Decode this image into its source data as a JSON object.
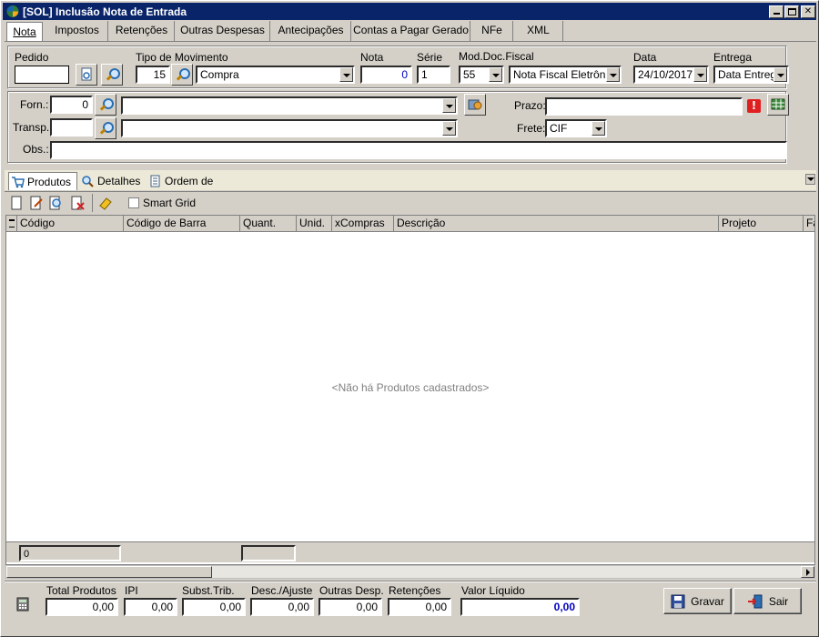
{
  "window": {
    "title": "[SOL] Inclusão Nota de Entrada"
  },
  "tabs": [
    "Nota",
    "Impostos",
    "Retenções",
    "Outras Despesas",
    "Antecipações",
    "Contas a Pagar Gerado",
    "NFe",
    "XML"
  ],
  "header_form": {
    "pedido_label": "Pedido",
    "pedido_value": "",
    "tipo_mov_label": "Tipo de Movimento",
    "tipo_mov_code": "15",
    "tipo_mov_desc": "Compra",
    "nota_label": "Nota",
    "nota_value": "0",
    "serie_label": "Série",
    "serie_value": "1",
    "mod_doc_label": "Mod.Doc.Fiscal",
    "mod_doc_code": "55",
    "mod_doc_desc": "Nota Fiscal Eletrônica",
    "data_label": "Data",
    "data_value": "24/10/2017",
    "entrega_label": "Entrega",
    "entrega_value": "Data Entrega"
  },
  "party_form": {
    "forn_label": "Forn.:",
    "forn_code": "0",
    "forn_name": "",
    "transp_label": "Transp.:",
    "transp_code": "",
    "transp_name": "",
    "prazo_label": "Prazo:",
    "prazo_value": "",
    "frete_label": "Frete:",
    "frete_value": "CIF",
    "obs_label": "Obs.:",
    "obs_value": ""
  },
  "subtabs": [
    "Produtos",
    "Detalhes",
    "Ordem de Compra"
  ],
  "toolbar": {
    "smart_grid_label": "Smart Grid",
    "smart_grid_checked": false
  },
  "grid": {
    "columns": [
      "Código",
      "Código de Barra",
      "Quant.",
      "Unid.",
      "xCompras",
      "Descrição",
      "Projeto",
      "Fa"
    ],
    "empty_text": "<Não há Produtos cadastrados>",
    "footer_count": "0"
  },
  "totals": {
    "total_produtos_label": "Total Produtos",
    "total_produtos": "0,00",
    "ipi_label": "IPI",
    "ipi": "0,00",
    "subst_label": "Subst.Trib.",
    "subst": "0,00",
    "desc_label": "Desc./Ajuste",
    "desc": "0,00",
    "outras_label": "Outras Desp.",
    "outras": "0,00",
    "ret_label": "Retenções",
    "ret": "0,00",
    "liquido_label": "Valor Líquido",
    "liquido": "0,00"
  },
  "actions": {
    "save_label": "Gravar",
    "exit_label": "Sair"
  },
  "colors": {
    "title_bg": "#0a246a",
    "liquido_fg": "#0000c0",
    "alert": "#e02020"
  }
}
